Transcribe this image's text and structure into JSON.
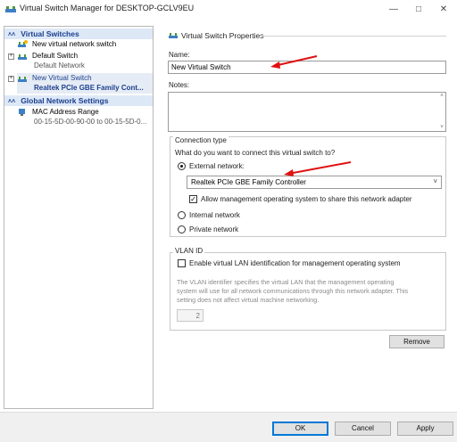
{
  "window": {
    "title": "Virtual Switch Manager for DESKTOP-GCLV9EU",
    "icon": "switch-manager-icon"
  },
  "tree": {
    "virtual_switches_header": "Virtual Switches",
    "new_switch": "New virtual network switch",
    "default_switch": "Default Switch",
    "default_switch_sub": "Default Network",
    "new_virtual_switch": "New Virtual Switch",
    "new_virtual_switch_sub": "Realtek PCIe GBE Family Cont...",
    "global_header": "Global Network Settings",
    "mac_range": "MAC Address Range",
    "mac_range_sub": "00-15-5D-00-90-00 to 00-15-5D-0..."
  },
  "props": {
    "header": "Virtual Switch Properties",
    "name_label": "Name:",
    "name_value": "New Virtual Switch",
    "notes_label": "Notes:",
    "notes_value": "",
    "connection_type_label": "Connection type",
    "connection_question": "What do you want to connect this virtual switch to?",
    "external_label": "External network:",
    "adapter_value": "Realtek PCIe GBE Family Controller",
    "allow_mgmt_label": "Allow management operating system to share this network adapter",
    "internal_label": "Internal network",
    "private_label": "Private network",
    "vlan_group_label": "VLAN ID",
    "vlan_enable_label": "Enable virtual LAN identification for management operating system",
    "vlan_desc_1": "The VLAN identifier specifies the virtual LAN that the management operating",
    "vlan_desc_2": "system will use for all network communications through this network adapter. This",
    "vlan_desc_3": "setting does not affect virtual machine networking.",
    "vlan_value": "2",
    "remove_label": "Remove"
  },
  "footer": {
    "ok_label": "OK",
    "cancel_label": "Cancel",
    "apply_label": "Apply"
  },
  "state": {
    "connection_type": "external",
    "allow_mgmt_checked": true,
    "vlan_enabled": false
  },
  "colors": {
    "accent": "#0078d7",
    "section_header_bg": "#dde8f7",
    "section_header_text": "#1b3f8e",
    "annotation_arrow": "#e01010"
  }
}
